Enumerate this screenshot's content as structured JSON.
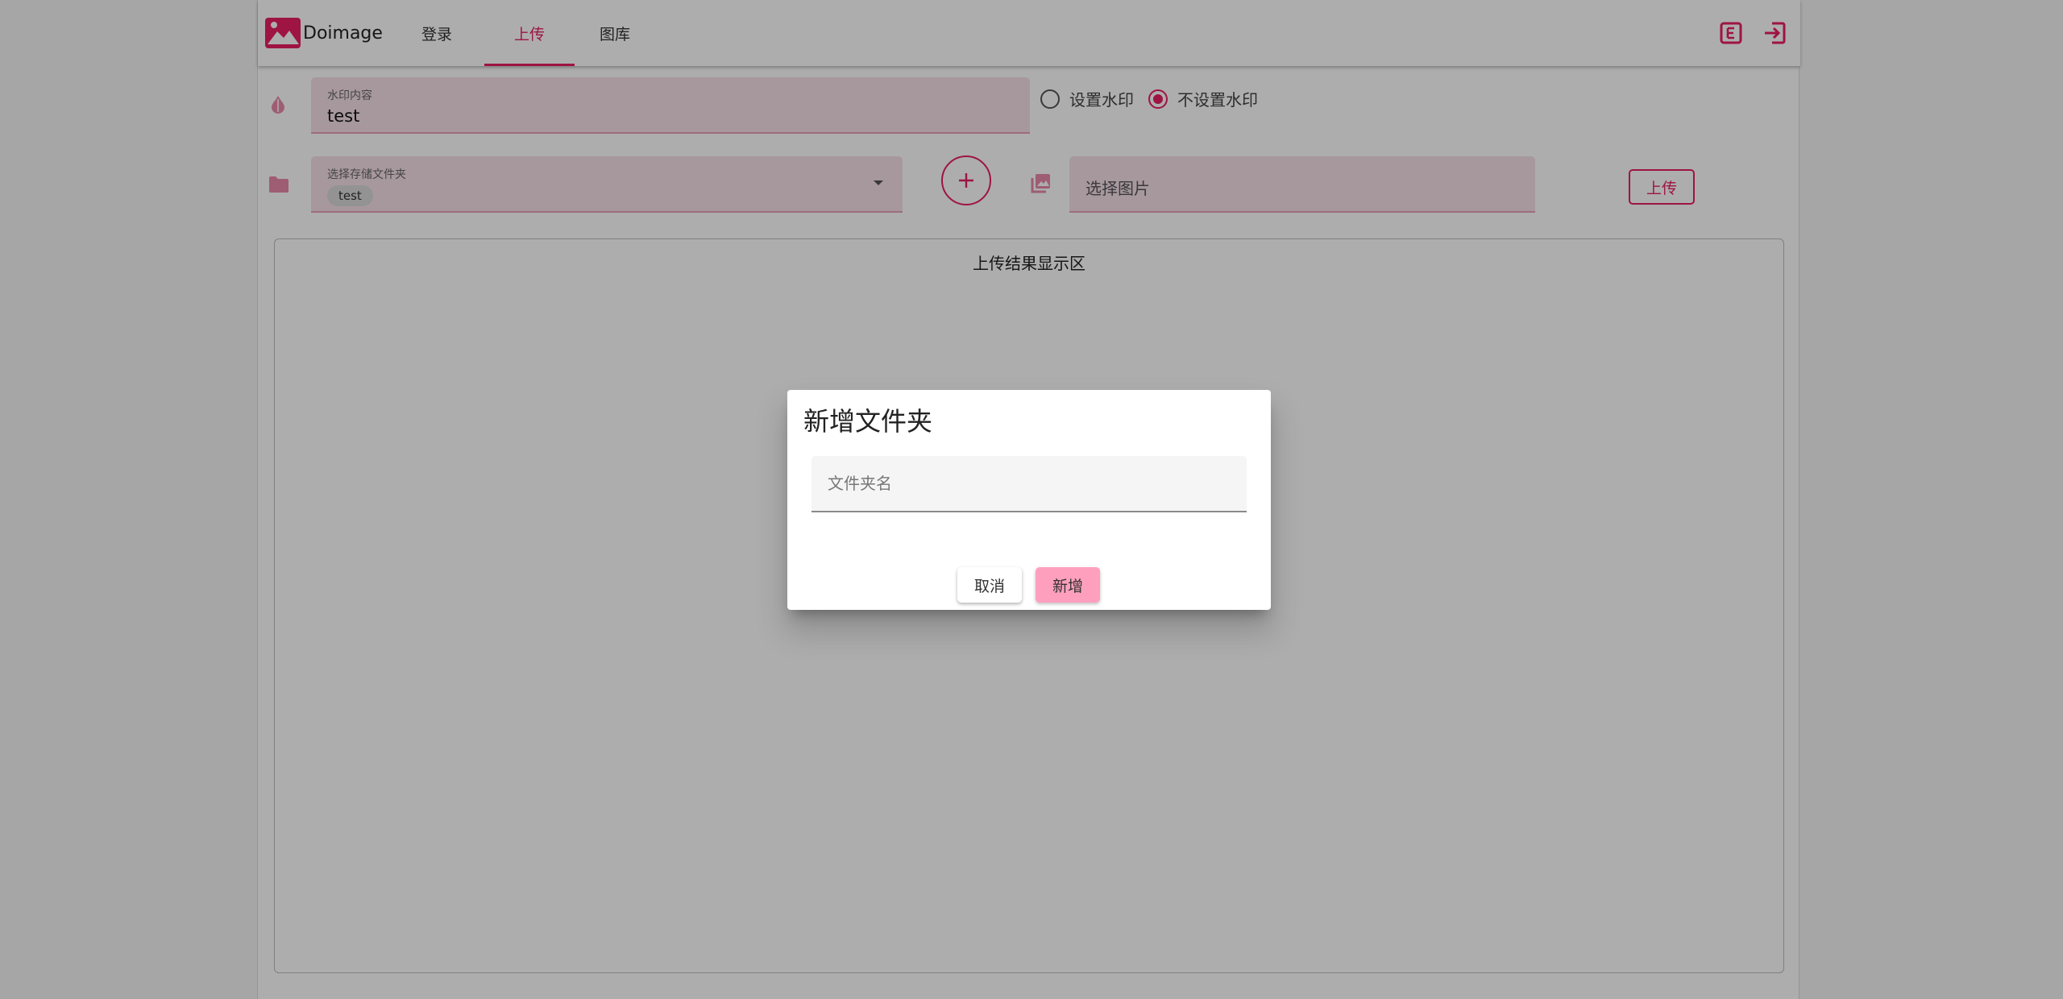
{
  "app": {
    "brand": "Doimage",
    "accent": "#e91e63"
  },
  "nav": {
    "tabs": [
      {
        "label": "登录"
      },
      {
        "label": "上传",
        "active": true
      },
      {
        "label": "图库"
      }
    ],
    "icons": [
      "edit-square-icon",
      "logout-icon"
    ]
  },
  "watermark": {
    "icon": "watermark-drop-icon",
    "label": "水印内容",
    "value": "test",
    "options": [
      "设置水印",
      "不设置水印"
    ],
    "selected": "不设置水印"
  },
  "folder": {
    "icon": "folder-icon",
    "label": "选择存储文件夹",
    "selected_chip": "test",
    "add_icon": "plus-icon"
  },
  "image": {
    "icon": "image-stack-icon",
    "placeholder": "选择图片"
  },
  "upload_button": "上传",
  "result": {
    "title": "上传结果显示区"
  },
  "dialog": {
    "title": "新增文件夹",
    "input_placeholder": "文件夹名",
    "input_value": "",
    "cancel": "取消",
    "confirm": "新增"
  }
}
